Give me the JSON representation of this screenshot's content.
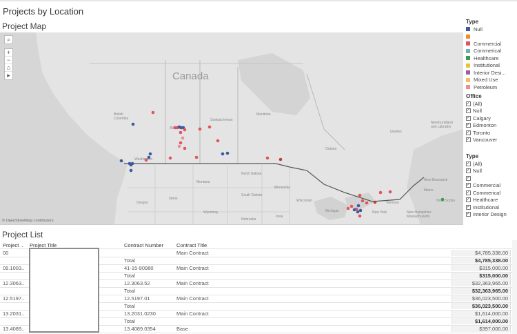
{
  "dashboard": {
    "title": "Projects by Location"
  },
  "map": {
    "title": "Project Map",
    "labels": {
      "canada": "Canada",
      "british_columbia": "British\nColumbia",
      "alberta": "Alberta",
      "saskatchewan": "Saskatchewan",
      "manitoba": "Manitoba",
      "ontario": "Ontario",
      "quebec": "Quebec",
      "newfoundland": "Newfoundland and Labrador",
      "washington": "Washington",
      "oregon": "Oregon",
      "idaho": "Idaho",
      "montana": "Montana",
      "north_dakota": "North Dakota",
      "south_dakota": "South Dakota",
      "minnesota": "Minnesota",
      "michigan": "Michigan",
      "wisconsin": "Wisconsin",
      "new_york": "New York",
      "vermont": "Vermont",
      "maine": "Maine",
      "new_brunswick": "New Brunswick",
      "nova_scotia": "Nova Scotia",
      "new_hampshire_mass": "New Hampshire\nMassachusetts",
      "iowa": "Iowa",
      "wyoming": "Wyoming",
      "nebraska": "Nebraska"
    },
    "attribution": "© OpenStreetMap contributors",
    "controls": {
      "search": "⌕",
      "zoom_in": "+",
      "zoom_out": "−",
      "home": "⌂",
      "more": "▸"
    },
    "colors": {
      "blue": "#3c5a9e",
      "red": "#e0555d",
      "pink": "#f08b8f",
      "green": "#3a9b4a",
      "orange": "#e8912a",
      "darkred": "#b8432f"
    }
  },
  "legend": {
    "type_title": "Type",
    "items": [
      {
        "label": "Null",
        "color": "#3c5a9e"
      },
      {
        "label": "",
        "color": "#e8912a"
      },
      {
        "label": "Commercial",
        "color": "#e0555d"
      },
      {
        "label": "Commerical",
        "color": "#6ab3b0"
      },
      {
        "label": "Healthcare",
        "color": "#3a9b4a"
      },
      {
        "label": "Institutional",
        "color": "#e8c33a"
      },
      {
        "label": "Interior Desi...",
        "color": "#a05aa0"
      },
      {
        "label": "Mixed Use",
        "color": "#f0c05a"
      },
      {
        "label": "Petroleum",
        "color": "#f08b8f"
      }
    ]
  },
  "office_filter": {
    "title": "Office",
    "options": [
      "(All)",
      "Null",
      "Calgary",
      "Edmonton",
      "Toronto",
      "Vancouver"
    ]
  },
  "type_filter": {
    "title": "Type",
    "options": [
      "(All)",
      "Null",
      "",
      "Commercial",
      "Commerical",
      "Healthcare",
      "Institutional",
      "Interior Design"
    ]
  },
  "project_list": {
    "title": "Project List",
    "headers": {
      "project_id": "Project ..",
      "project_title": "Project Title",
      "contract_number": "Contract Number",
      "contract_title": "Contract Title"
    },
    "rows": [
      {
        "project_id": "00",
        "contract_number": "",
        "contract_title": "Main Contract",
        "amount": "$4,785,338.00",
        "total_label": "Total",
        "total": "$4,785,338.00"
      },
      {
        "project_id": "09.1003..",
        "contract_number": "41-15-90980",
        "contract_title": "Main Contract",
        "amount": "$315,000.00",
        "total_label": "Total",
        "total": "$315,000.00"
      },
      {
        "project_id": "12.3063..",
        "contract_number": "12.3063.52",
        "contract_title": "Main Contract",
        "amount": "$32,363,965.00",
        "total_label": "Total",
        "total": "$32,363,965.00"
      },
      {
        "project_id": "12.5197..",
        "contract_number": "12.5197.01",
        "contract_title": "Main Contract",
        "amount": "$36,023,500.00",
        "total_label": "Total",
        "total": "$36,023,500.00"
      },
      {
        "project_id": "13.2031..",
        "contract_number": "13.2031.0230",
        "contract_title": "Main Contract",
        "amount": "$1,614,000.00",
        "total_label": "Total",
        "total": "$1,614,000.00"
      },
      {
        "project_id": "13.4089..",
        "contract_number": "13.4089.0354",
        "contract_title": "Base",
        "amount": "$397,000.00",
        "total_label": "",
        "total": ""
      }
    ]
  }
}
